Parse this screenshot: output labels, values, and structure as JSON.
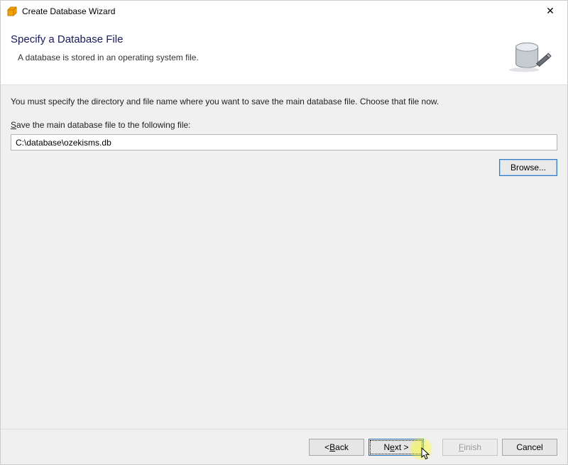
{
  "titlebar": {
    "title": "Create Database Wizard"
  },
  "header": {
    "title": "Specify a Database File",
    "subtitle": "A database is stored in an operating system file."
  },
  "content": {
    "instruction": "You must specify the directory and file name where you want to save the main database file. Choose that file now.",
    "save_label_pre": "S",
    "save_label_rest": "ave the main database file to the following file:",
    "path_value": "C:\\database\\ozekisms.db",
    "browse_label_pre": "B",
    "browse_label_rest": "rowse..."
  },
  "footer": {
    "back_pre": "< ",
    "back_ul": "B",
    "back_rest": "ack",
    "next_pre": "N",
    "next_ul": "e",
    "next_rest": "xt >",
    "finish_pre": "",
    "finish_ul": "F",
    "finish_rest": "inish",
    "cancel": "Cancel"
  }
}
